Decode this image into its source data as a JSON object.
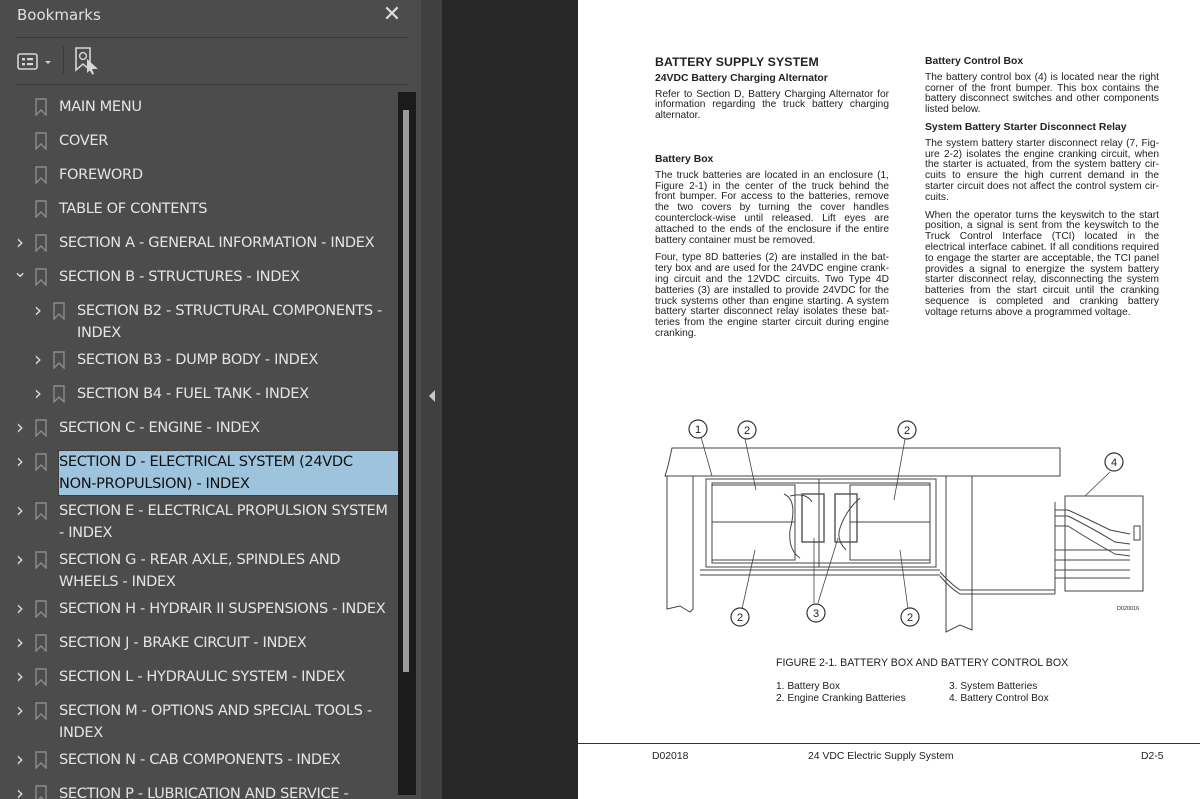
{
  "sidebar": {
    "title": "Bookmarks",
    "close_icon": "close-icon",
    "toolbar": {
      "options_icon": "list-options-icon",
      "find_bookmark_icon": "find-current-bookmark-icon"
    },
    "items": [
      {
        "label": "MAIN MENU",
        "level": 0,
        "expander": "none"
      },
      {
        "label": "COVER",
        "level": 0,
        "expander": "none"
      },
      {
        "label": "FOREWORD",
        "level": 0,
        "expander": "none"
      },
      {
        "label": "TABLE OF CONTENTS",
        "level": 0,
        "expander": "none"
      },
      {
        "label": "SECTION A - GENERAL INFORMATION - INDEX",
        "level": 0,
        "expander": "collapsed"
      },
      {
        "label": "SECTION B - STRUCTURES - INDEX",
        "level": 0,
        "expander": "expanded"
      },
      {
        "label": "SECTION B2 - STRUCTURAL COMPONENTS -\nINDEX",
        "level": 1,
        "expander": "collapsed"
      },
      {
        "label": "SECTION B3 - DUMP BODY - INDEX",
        "level": 1,
        "expander": "collapsed"
      },
      {
        "label": "SECTION B4 - FUEL TANK - INDEX",
        "level": 1,
        "expander": "collapsed"
      },
      {
        "label": "SECTION C - ENGINE - INDEX",
        "level": 0,
        "expander": "collapsed"
      },
      {
        "label": "SECTION D - ELECTRICAL SYSTEM (24VDC\nNON-PROPULSION) - INDEX",
        "level": 0,
        "expander": "collapsed",
        "selected": true
      },
      {
        "label": "SECTION E - ELECTRICAL PROPULSION SYSTEM\n- INDEX",
        "level": 0,
        "expander": "collapsed"
      },
      {
        "label": "SECTION G - REAR AXLE, SPINDLES AND\nWHEELS - INDEX",
        "level": 0,
        "expander": "collapsed"
      },
      {
        "label": "SECTION H - HYDRAIR II SUSPENSIONS - INDEX",
        "level": 0,
        "expander": "collapsed"
      },
      {
        "label": "SECTION J - BRAKE CIRCUIT - INDEX",
        "level": 0,
        "expander": "collapsed"
      },
      {
        "label": "SECTION L - HYDRAULIC SYSTEM - INDEX",
        "level": 0,
        "expander": "collapsed"
      },
      {
        "label": "SECTION M - OPTIONS AND SPECIAL TOOLS -\nINDEX",
        "level": 0,
        "expander": "collapsed"
      },
      {
        "label": "SECTION N - CAB COMPONENTS - INDEX",
        "level": 0,
        "expander": "collapsed"
      },
      {
        "label": "SECTION P - LUBRICATION AND SERVICE -",
        "level": 0,
        "expander": "collapsed"
      }
    ],
    "selection_color": "#9ec3dc"
  },
  "document": {
    "left_column": {
      "heading": "BATTERY SUPPLY SYSTEM",
      "sections": [
        {
          "subheading": "24VDC Battery Charging Alternator",
          "paragraphs": [
            "Refer to Section D, Battery Charging Alternator for information regarding the truck battery charging alternator."
          ]
        },
        {
          "subheading": "Battery Box",
          "paragraphs": [
            "The truck batteries are located in an enclosure (1, Figure 2-1) in the center of the truck behind the front bumper. For access to the batteries, remove the two covers by turning the cover handles counterclock-wise until released. Lift eyes are attached to the ends of the enclosure if the entire battery container must be removed.",
            "Four, type 8D batteries (2) are installed in the bat-tery box and are used for the 24VDC engine crank-ing circuit and the 12VDC circuits. Two Type 4D batteries (3) are installed to provide 24VDC for the truck systems other than engine starting. A system battery starter disconnect relay isolates these bat-teries from the engine starter circuit during engine cranking."
          ]
        }
      ]
    },
    "right_column": {
      "sections": [
        {
          "subheading": "Battery Control Box",
          "paragraphs": [
            "The battery control box (4) is located near the right corner of the front bumper. This box contains the battery disconnect switches and other components listed below."
          ]
        },
        {
          "subheading": "System Battery Starter Disconnect Relay",
          "paragraphs": [
            "The system battery starter disconnect relay (7, Fig-ure 2-2) isolates the engine cranking circuit, when the starter is actuated, from the system battery cir-cuits to ensure the high current demand in the starter circuit does not affect the control system cir-cuits.",
            "When the operator turns the keyswitch to the start position, a signal is sent from the keyswitch to the Truck Control Interface (TCI) located in the electrical interface cabinet. If all conditions required to engage the starter are acceptable, the TCI panel provides a signal to energize the system battery starter disconnect relay, disconnecting the system batteries from the start circuit until the cranking sequence is completed and cranking battery voltage returns above a programmed voltage."
          ]
        }
      ]
    },
    "figure": {
      "callouts": [
        "1",
        "2",
        "2",
        "2",
        "2",
        "3",
        "4"
      ],
      "drawing_id": "D020016",
      "caption": "FIGURE 2-1. BATTERY BOX AND BATTERY CONTROL BOX",
      "legend_left": [
        "1. Battery Box",
        "2. Engine Cranking Batteries"
      ],
      "legend_right": [
        "3. System Batteries",
        "4. Battery Control Box"
      ]
    },
    "footer": {
      "left": "D02018",
      "center": "24 VDC Electric Supply System",
      "right": "D2-5"
    }
  }
}
